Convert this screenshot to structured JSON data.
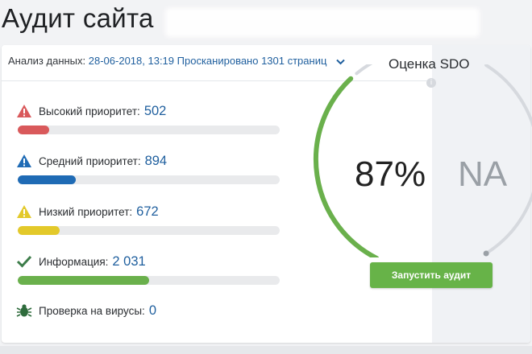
{
  "header": {
    "title": "Аудит сайта"
  },
  "analysis": {
    "label": "Анализ данных:",
    "datetime": "28-06-2018, 13:19",
    "scanned": "Просканировано 1301 страниц"
  },
  "priorities": [
    {
      "label": "Высокий приоритет:",
      "count": "502",
      "fill_pct": 12,
      "color": "#d9595b",
      "icon": "warning-triangle-red-icon"
    },
    {
      "label": "Средний приоритет:",
      "count": "894",
      "fill_pct": 22,
      "color": "#1f6bb5",
      "icon": "warning-triangle-blue-icon"
    },
    {
      "label": "Низкий приоритет:",
      "count": "672",
      "fill_pct": 16,
      "color": "#e3c92a",
      "icon": "warning-triangle-yellow-icon"
    },
    {
      "label": "Информация:",
      "count": "2 031",
      "fill_pct": 50,
      "color": "#6ab04c",
      "icon": "checkmark-icon"
    }
  ],
  "virus": {
    "label": "Проверка на вирусы:",
    "count": "0",
    "icon": "bug-icon"
  },
  "score": {
    "title": "Оценка SDO",
    "value": "87%",
    "value_fraction": 0.87,
    "secondary": "NA"
  },
  "actions": {
    "run_audit": "Запустить аудит"
  },
  "colors": {
    "accent_green": "#67b348",
    "link_blue": "#1f5f9e",
    "gauge_track": "#d6d9de"
  }
}
